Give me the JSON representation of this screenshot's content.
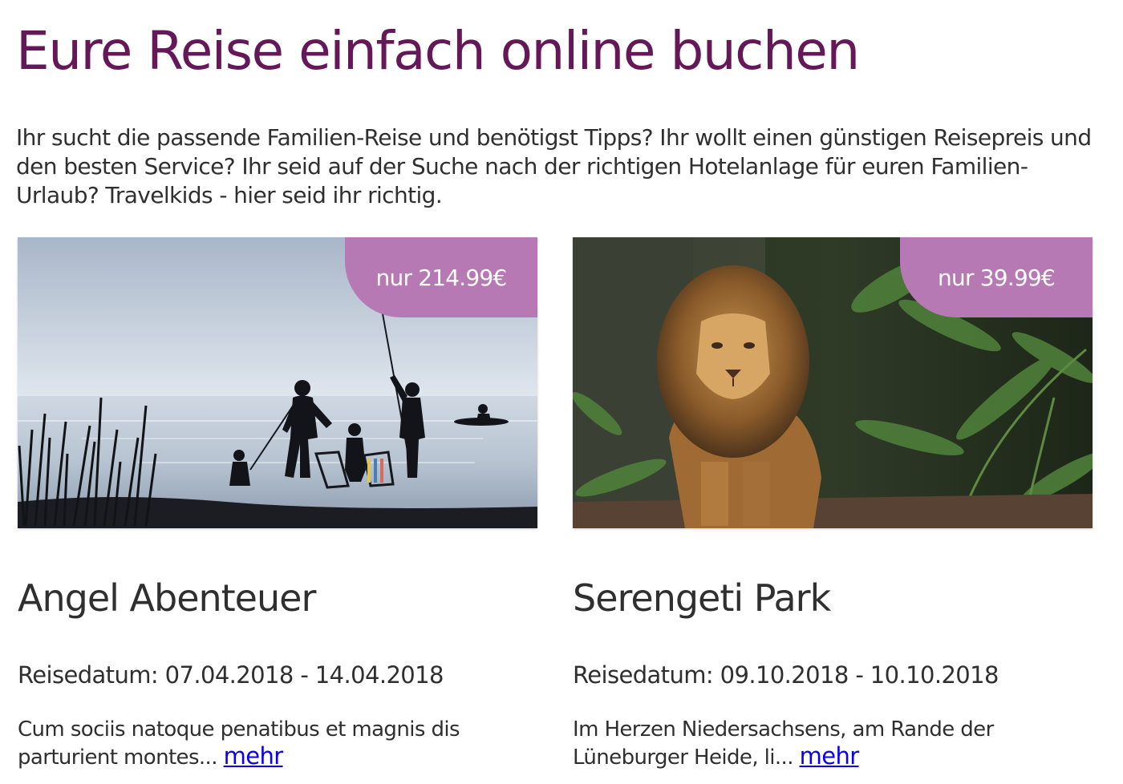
{
  "colors": {
    "title": "#651858",
    "text": "#2f2f2f",
    "badge": "#b679b3",
    "link": "#0b00ee"
  },
  "header": {
    "title": "Eure Reise einfach online buchen"
  },
  "intro": {
    "text": "Ihr sucht die passende Familien-Reise und benötigst Tipps? Ihr wollt einen günstigen Reisepreis und den besten Service? Ihr seid auf der Suche nach der richtigen Hotelanlage für euren Familien-Urlaub? Travelkids - hier seid ihr richtig."
  },
  "offers": [
    {
      "price": "nur 214.99€",
      "title": "Angel Abenteuer",
      "date": "Reisedatum: 07.04.2018 - 14.04.2018",
      "excerpt": "Cum sociis natoque penatibus et magnis dis parturient montes... ",
      "more_label": "mehr",
      "image": "family-fishing-lake-photo"
    },
    {
      "price": "nur 39.99€",
      "title": "Serengeti Park",
      "date": "Reisedatum: 09.10.2018 - 10.10.2018",
      "excerpt": "Im Herzen Niedersachsens, am Rande der Lüneburger Heide, li... ",
      "more_label": "mehr",
      "image": "lion-jungle-photo"
    }
  ]
}
